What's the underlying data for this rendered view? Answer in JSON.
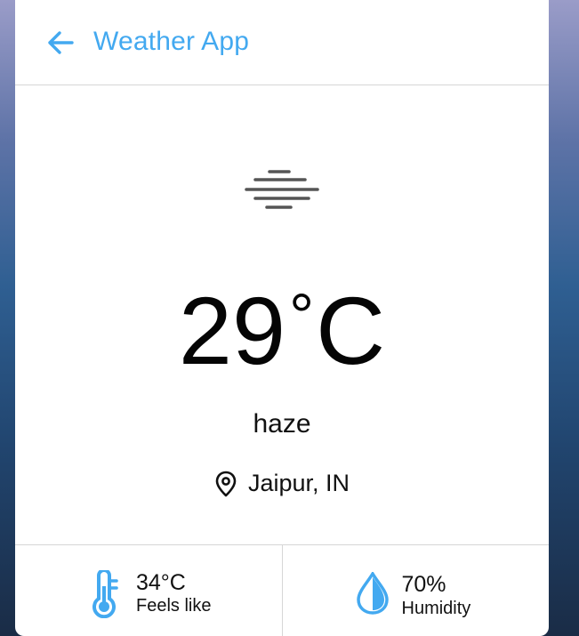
{
  "header": {
    "title": "Weather App",
    "back_icon": "arrow-left-icon"
  },
  "current": {
    "condition_icon": "haze-icon",
    "temperature": "29",
    "degree_symbol": "°",
    "unit": "C",
    "description": "haze",
    "location_icon": "map-pin-icon",
    "location": "Jaipur, IN"
  },
  "details": [
    {
      "icon": "thermometer-icon",
      "value": "34°C",
      "label": "Feels like"
    },
    {
      "icon": "water-drop-icon",
      "value": "70%",
      "label": "Humidity"
    }
  ],
  "colors": {
    "accent": "#43a9f0",
    "text": "#111111",
    "divider": "#d6d6d6",
    "icon_gray": "#555555"
  }
}
